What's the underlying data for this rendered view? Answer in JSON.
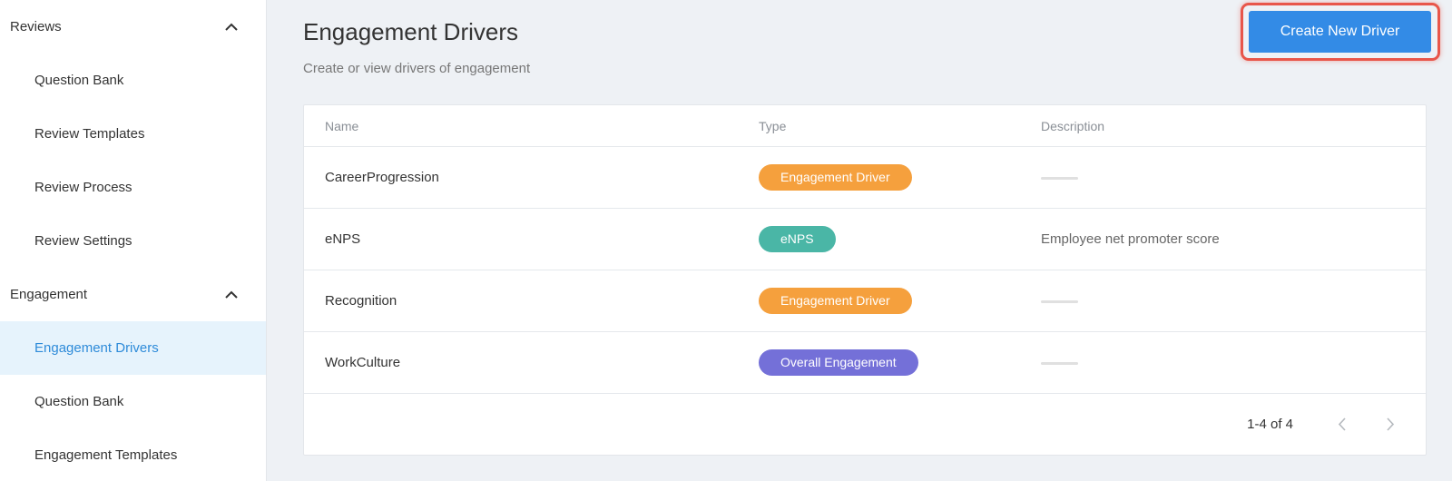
{
  "sidebar": {
    "sections": [
      {
        "label": "Reviews",
        "items": [
          "Question Bank",
          "Review Templates",
          "Review Process",
          "Review Settings"
        ]
      },
      {
        "label": "Engagement",
        "items": [
          "Engagement Drivers",
          "Question Bank",
          "Engagement Templates"
        ]
      }
    ],
    "active_item": "Engagement Drivers"
  },
  "header": {
    "title": "Engagement Drivers",
    "subtitle": "Create or view drivers of engagement",
    "create_button": "Create New Driver"
  },
  "table": {
    "columns": [
      "Name",
      "Type",
      "Description"
    ],
    "rows": [
      {
        "name": "CareerProgression",
        "type": "Engagement Driver",
        "type_color": "#f5a03d",
        "description": ""
      },
      {
        "name": "eNPS",
        "type": "eNPS",
        "type_color": "#4ab6a6",
        "description": "Employee net promoter score"
      },
      {
        "name": "Recognition",
        "type": "Engagement Driver",
        "type_color": "#f5a03d",
        "description": ""
      },
      {
        "name": "WorkCulture",
        "type": "Overall Engagement",
        "type_color": "#7470d8",
        "description": ""
      }
    ]
  },
  "pagination": {
    "range_text": "1-4 of 4",
    "prev_icon": "chevron-left-icon",
    "next_icon": "chevron-right-icon"
  },
  "colors": {
    "accent": "#338be6",
    "active_bg": "#e6f3fc",
    "highlight_border": "#e8564a"
  }
}
